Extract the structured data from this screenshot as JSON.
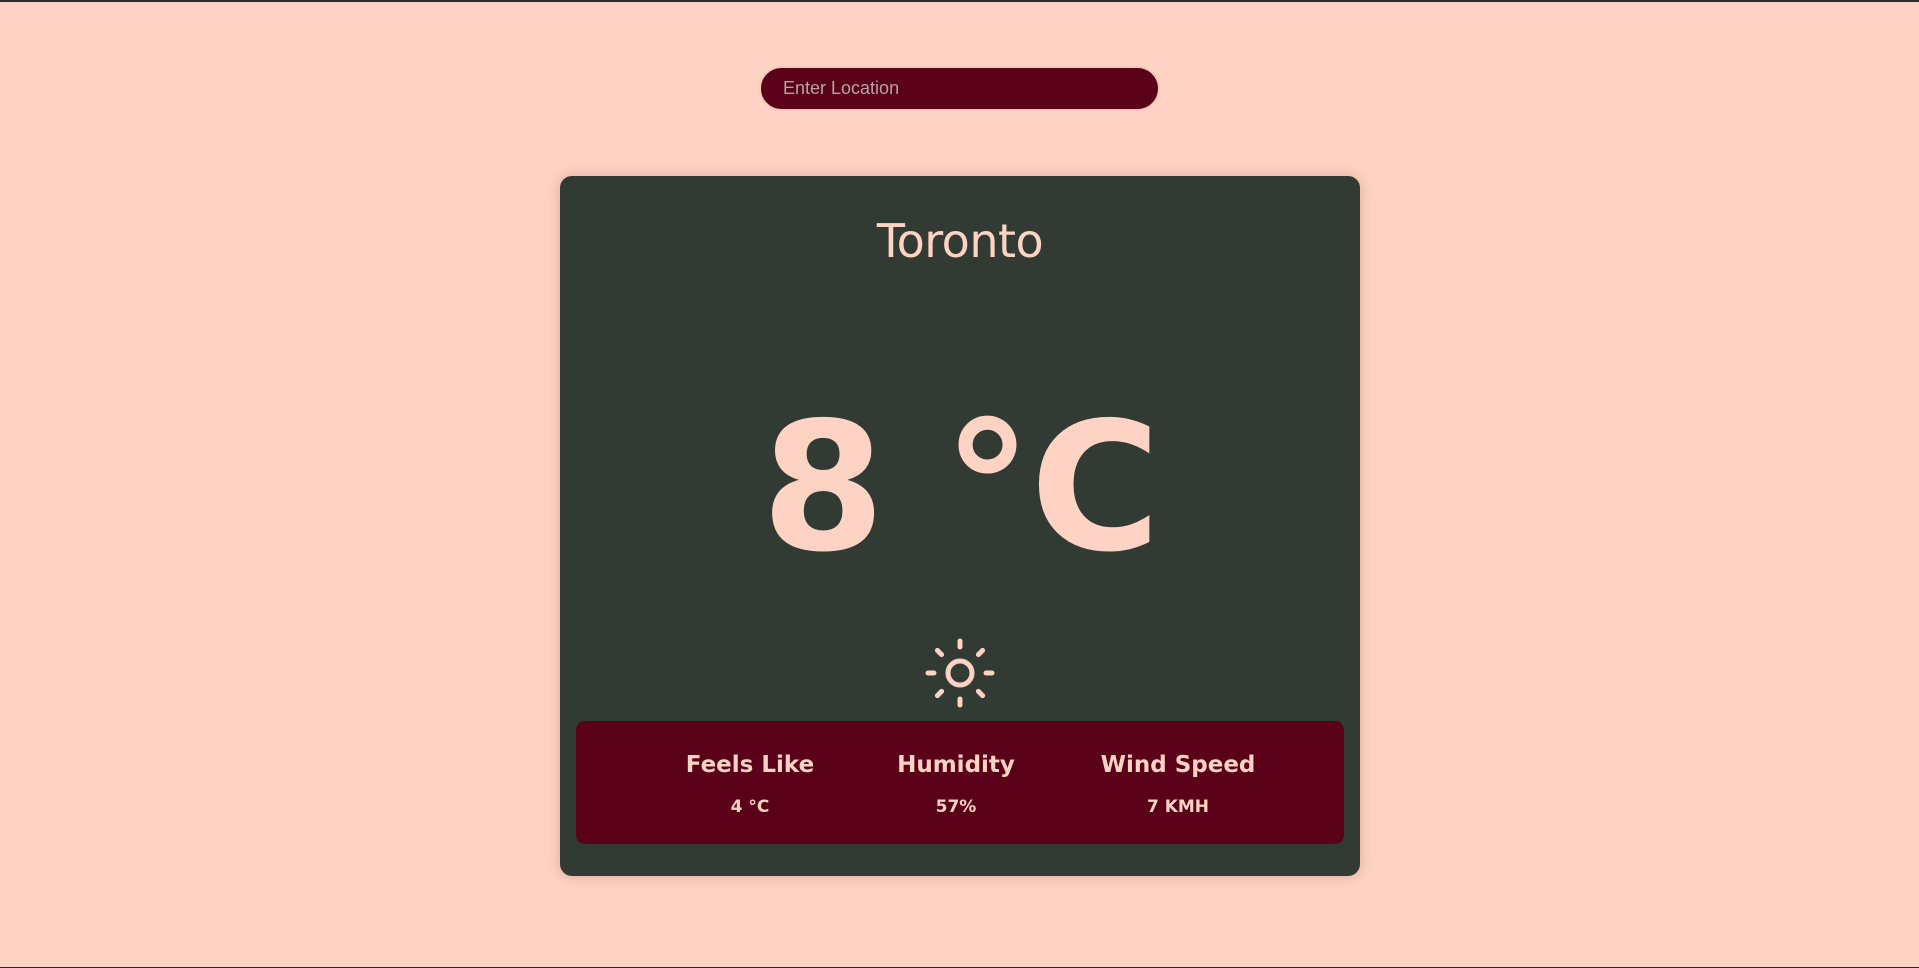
{
  "search": {
    "placeholder": "Enter Location",
    "value": ""
  },
  "weather": {
    "city": "Toronto",
    "temperature": "8 °C",
    "condition_icon": "sun-icon",
    "stats": {
      "feels_like": {
        "label": "Feels Like",
        "value": "4 °C"
      },
      "humidity": {
        "label": "Humidity",
        "value": "57%"
      },
      "wind_speed": {
        "label": "Wind Speed",
        "value": "7 KMH"
      }
    }
  },
  "colors": {
    "background": "#ffd3c3",
    "card": "#323a34",
    "accent": "#5a0018",
    "text": "#ffd3c3"
  }
}
